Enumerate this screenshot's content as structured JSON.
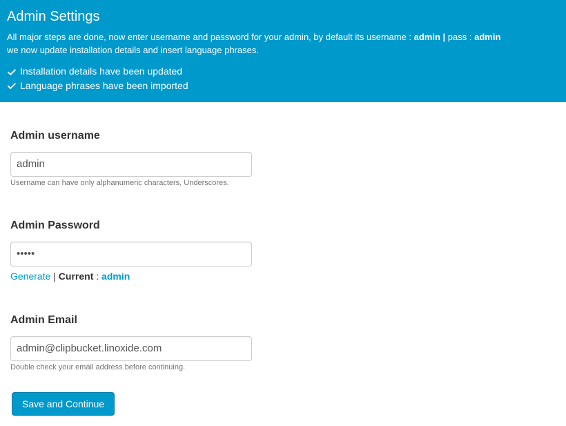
{
  "header": {
    "title": "Admin Settings",
    "line1_prefix": "All major steps are done, now enter username and password for your admin, by default its username : ",
    "line1_user": "admin |",
    "line1_pass_label": " pass : ",
    "line1_pass": "admin",
    "line2": "we now update installation details and insert language phrases.",
    "status1": "Installation details have been updated",
    "status2": "Language phrases have been imported"
  },
  "form": {
    "username": {
      "label": "Admin username",
      "value": "admin",
      "help": "Username can have only alphanumeric characters, Underscores."
    },
    "password": {
      "label": "Admin Password",
      "value": "•••••",
      "generate": "Generate",
      "sep": " | ",
      "current_label": "Current",
      "colon": " : ",
      "current_value": "admin"
    },
    "email": {
      "label": "Admin Email",
      "value": "admin@clipbucket.linoxide.com",
      "help": "Double check your email address before continuing."
    },
    "submit": "Save and Continue"
  }
}
